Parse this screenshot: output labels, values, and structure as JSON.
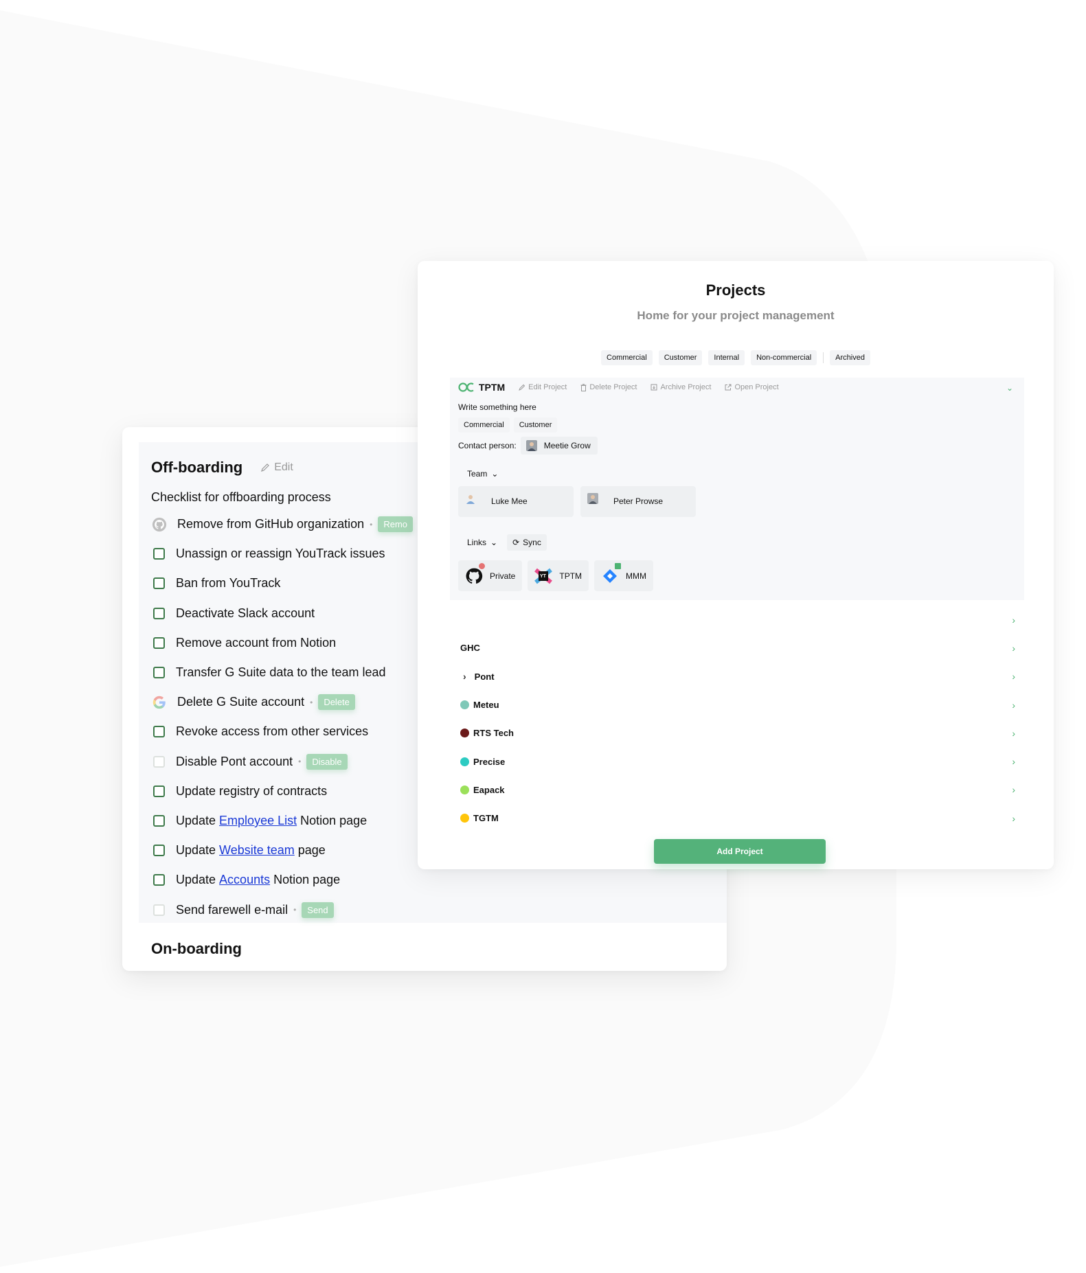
{
  "offboarding": {
    "title": "Off-boarding",
    "edit_label": "Edit",
    "description": "Checklist for offboarding process",
    "items": [
      {
        "icon": "github-icon",
        "parts": [
          "Remove from GitHub organization"
        ],
        "badge": "Remove",
        "badge_visible": "Remo"
      },
      {
        "icon": "checkbox",
        "parts": [
          "Unassign or reassign YouTrack issues"
        ]
      },
      {
        "icon": "checkbox",
        "parts": [
          "Ban from YouTrack"
        ]
      },
      {
        "icon": "checkbox",
        "parts": [
          "Deactivate Slack account"
        ]
      },
      {
        "icon": "checkbox",
        "parts": [
          "Remove account from Notion"
        ]
      },
      {
        "icon": "checkbox",
        "parts": [
          "Transfer G Suite data to the team lead"
        ]
      },
      {
        "icon": "google-icon",
        "parts": [
          "Delete G Suite account"
        ],
        "badge": "Delete"
      },
      {
        "icon": "checkbox",
        "parts": [
          "Revoke access from other services"
        ]
      },
      {
        "icon": "checkbox-faint",
        "parts": [
          "Disable Pont account"
        ],
        "badge": "Disable"
      },
      {
        "icon": "checkbox",
        "parts": [
          "Update registry of contracts"
        ]
      },
      {
        "icon": "checkbox",
        "prefix": "Update ",
        "link": "Employee List",
        "suffix": " Notion page"
      },
      {
        "icon": "checkbox",
        "prefix": "Update ",
        "link": "Website team",
        "suffix": " page"
      },
      {
        "icon": "checkbox",
        "prefix": "Update ",
        "link": "Accounts",
        "suffix": " Notion page"
      },
      {
        "icon": "checkbox-faint",
        "parts": [
          "Send farewell e-mail"
        ],
        "badge": "Send"
      }
    ]
  },
  "onboarding": {
    "title": "On-boarding"
  },
  "projects": {
    "title": "Projects",
    "subtitle": "Home for your project management",
    "filters": [
      "Commercial",
      "Customer",
      "Internal",
      "Non-commercial"
    ],
    "archived_filter": "Archived",
    "expanded": {
      "name": "TPTM",
      "actions": {
        "edit": "Edit Project",
        "delete": "Delete Project",
        "archive": "Archive Project",
        "open": "Open Project"
      },
      "description": "Write something here",
      "tags": [
        "Commercial",
        "Customer"
      ],
      "contact_label": "Contact person:",
      "contact_name": "Meetie Grow",
      "team_label": "Team",
      "team": [
        "Luke Mee",
        "Peter Prowse"
      ],
      "links_label": "Links",
      "sync_label": "Sync",
      "links": [
        {
          "icon": "github-icon",
          "label": "Private",
          "badge": "remove"
        },
        {
          "icon": "youtrack-icon",
          "label": "TPTM"
        },
        {
          "icon": "jira-icon",
          "label": "MMM",
          "badge": "external"
        }
      ]
    },
    "list": [
      {
        "name": "",
        "icon": "none"
      },
      {
        "name": "GHC",
        "icon": "none"
      },
      {
        "name": "Pont",
        "icon": "chevron"
      },
      {
        "name": "Meteu",
        "icon": "meteu-logo",
        "color": "#7fc8b8"
      },
      {
        "name": "RTS Tech",
        "icon": "dot",
        "color": "#6b1a1a"
      },
      {
        "name": "Precise",
        "icon": "dot",
        "color": "#2ccbc2"
      },
      {
        "name": "Eapack",
        "icon": "dot",
        "color": "#9be05a"
      },
      {
        "name": "TGTM",
        "icon": "dot",
        "color": "#ffc50a"
      }
    ],
    "add_button": "Add Project"
  },
  "colors": {
    "accent_green": "#54b27a",
    "badge_green": "#a7d7b6",
    "link_blue": "#1a39d6",
    "checkbox_green": "#3e7a4a"
  }
}
